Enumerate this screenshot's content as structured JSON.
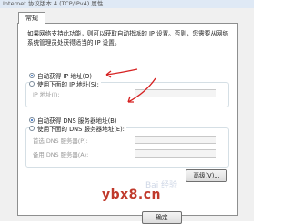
{
  "window": {
    "title": "Internet 协议版本 4 (TCP/IPv4) 属性"
  },
  "tabs": [
    {
      "label": "常规"
    }
  ],
  "description": "如果网络支持此功能，则可以获取自动指派的 IP 设置。否则，您需要从网络系统管理员处获得适当的 IP 设置。",
  "ip_section": {
    "auto_label": "自动获得 IP 地址(O)",
    "manual_label": "使用下面的 IP 地址(S):",
    "ip_address_label": "IP 地址(I):"
  },
  "dns_section": {
    "auto_label": "自动获得 DNS 服务器地址(B)",
    "manual_label": "使用下面的 DNS 服务器地址(E):",
    "preferred_label": "首选 DNS 服务器(P):",
    "alternate_label": "备用 DNS 服务器(A):"
  },
  "buttons": {
    "advanced": "高级(V)...",
    "ok": "确定"
  },
  "watermark": {
    "text": "ybx8.cn",
    "logo_text": "Bai 经验"
  },
  "colors": {
    "annotation_arrow": "#d62020",
    "watermark": "#c0392b",
    "radio_selected": "#1f5fbf"
  }
}
